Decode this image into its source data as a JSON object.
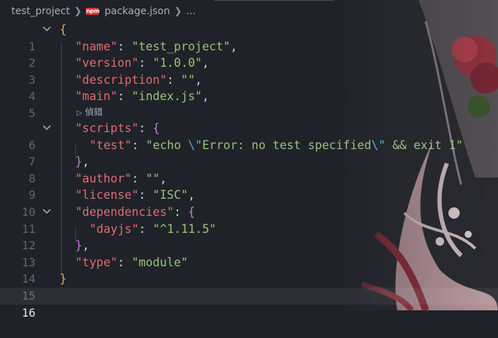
{
  "breadcrumb": {
    "folder": "test_project",
    "file": "package.json",
    "more": "..."
  },
  "codelens": {
    "label": "偵錯"
  },
  "lines": {
    "l1": {
      "num": "1",
      "open": "{"
    },
    "l2": {
      "num": "2",
      "key": "\"name\"",
      "value": "\"test_project\""
    },
    "l3": {
      "num": "3",
      "key": "\"version\"",
      "value": "\"1.0.0\""
    },
    "l4": {
      "num": "4",
      "key": "\"description\"",
      "value": "\"\""
    },
    "l5": {
      "num": "5",
      "key": "\"main\"",
      "value": "\"index.js\""
    },
    "l6": {
      "num": "6",
      "key": "\"scripts\"",
      "open": "{"
    },
    "l7": {
      "num": "7",
      "key": "\"test\"",
      "value_a": "\"echo ",
      "esc1": "\\\"",
      "value_b": "Error: no test specified",
      "esc2": "\\\"",
      "value_c": " && exit 1\""
    },
    "l8": {
      "num": "8",
      "close": "}"
    },
    "l9": {
      "num": "9",
      "key": "\"author\"",
      "value": "\"\""
    },
    "l10": {
      "num": "10",
      "key": "\"license\"",
      "value": "\"ISC\""
    },
    "l11": {
      "num": "11",
      "key": "\"dependencies\"",
      "open": "{"
    },
    "l12": {
      "num": "12",
      "key": "\"dayjs\"",
      "value": "\"^1.11.5\""
    },
    "l13": {
      "num": "13",
      "close": "}"
    },
    "l14": {
      "num": "14",
      "key": "\"type\"",
      "value": "\"module\""
    },
    "l15": {
      "num": "15",
      "close": "}"
    },
    "l16": {
      "num": "16"
    }
  },
  "colors": {
    "background": "#1f2229",
    "key": "#e06c75",
    "string": "#98c379",
    "escape": "#56b6c2",
    "brace_outer": "#e5a550",
    "brace_inner": "#c678dd",
    "npm_icon": "#cb3837"
  },
  "icons": {
    "npm": "npm-icon",
    "fold": "chevron-down-icon",
    "lens": "play-triangle-icon",
    "separator": "chevron-right-icon"
  }
}
